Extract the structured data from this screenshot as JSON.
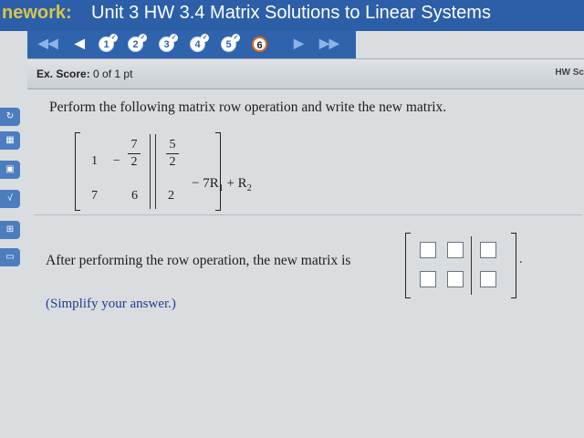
{
  "header": {
    "label": "nework:",
    "title": "Unit 3 HW 3.4 Matrix Solutions to Linear Systems"
  },
  "question_nav": {
    "items": [
      "1",
      "2",
      "3",
      "4",
      "5",
      "6"
    ],
    "current": "6",
    "checkmark": "✓"
  },
  "score": {
    "label": "Ex. Score:",
    "value": "0 of 1 pt",
    "right_label": "HW Sc"
  },
  "problem": {
    "prompt": "Perform the following matrix row operation and write the new matrix.",
    "matrix": {
      "r1c1": "1",
      "r1c2_sign": "−",
      "r1c2_num": "7",
      "r1c2_den": "2",
      "r1c3_num": "5",
      "r1c3_den": "2",
      "r2c1": "7",
      "r2c2": "6",
      "r2c3": "2"
    },
    "row_op": {
      "prefix": "− 7R",
      "sub1": "1",
      "plus": " + R",
      "sub2": "2"
    },
    "answer_text": "After performing the row operation, the new matrix is",
    "period": ".",
    "simplify": "(Simplify your answer.)"
  }
}
